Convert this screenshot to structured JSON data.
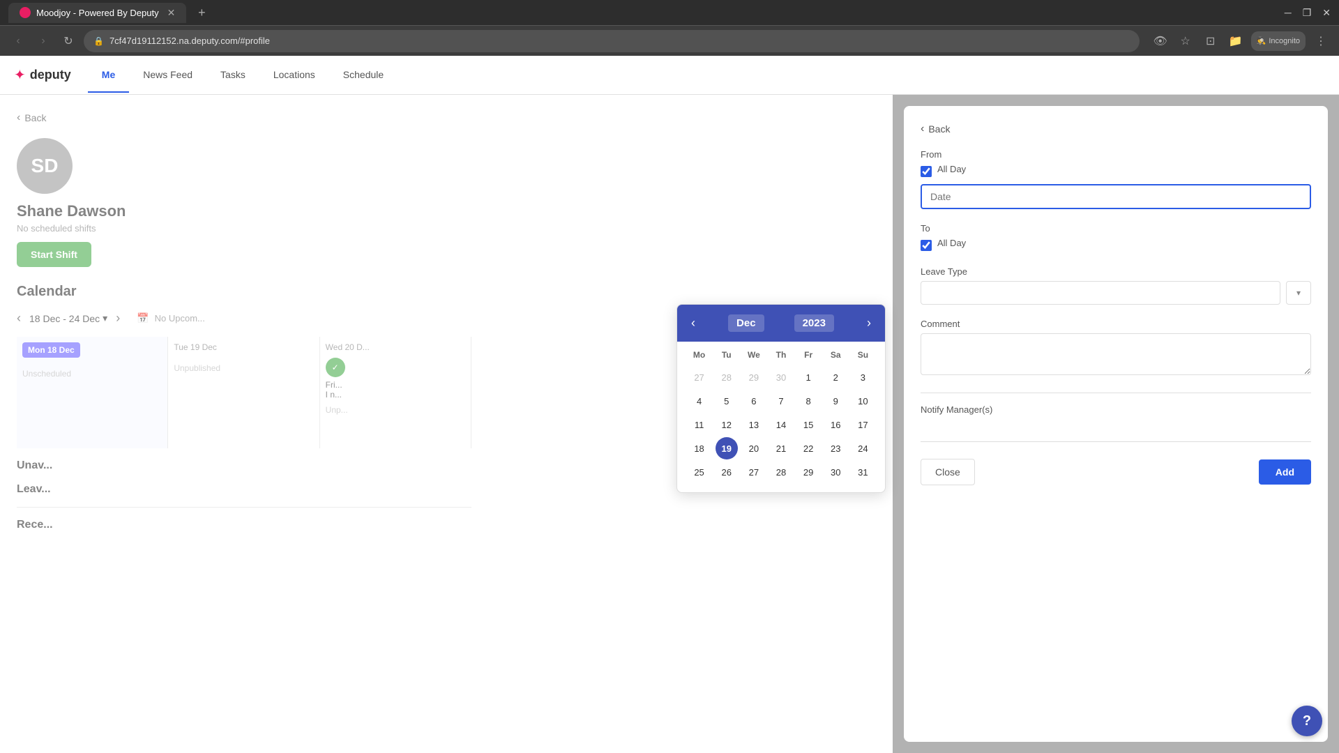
{
  "browser": {
    "tab_title": "Moodjoy - Powered By Deputy",
    "url": "7cf47d19112152.na.deputy.com/#profile",
    "incognito_label": "Incognito"
  },
  "nav": {
    "logo": "deputy",
    "tabs": [
      "Me",
      "News Feed",
      "Tasks",
      "Locations",
      "Schedule"
    ],
    "active_tab": "Me"
  },
  "profile": {
    "initials": "SD",
    "name": "Shane Dawson",
    "subtitle": "No scheduled shifts",
    "start_shift": "Start Shift"
  },
  "calendar": {
    "title": "Calendar",
    "range": "18 Dec - 24 Dec",
    "no_upcoming": "No Upcom...",
    "days": [
      {
        "label": "Mon 18 Dec",
        "active": true,
        "content": ""
      },
      {
        "label": "Tue 19 Dec",
        "active": false,
        "content": ""
      },
      {
        "label": "Wed 20 D...",
        "active": false,
        "content": ""
      }
    ],
    "unscheduled": "Unscheduled",
    "unpublished": "Unpublished",
    "unpublished2": "Unp..."
  },
  "unavailable": {
    "title": "Unav..."
  },
  "leave_section": {
    "title": "Leav..."
  },
  "recent_section": {
    "title": "Rece..."
  },
  "back_btn": "Back",
  "dialog": {
    "back_btn": "Back",
    "from_label": "From",
    "to_label": "To",
    "all_day_label": "All Day",
    "date_placeholder": "Date",
    "leave_type_label": "Leave Type",
    "comment_label": "Comment",
    "notify_label": "Notify Manager(s)",
    "close_btn": "Close",
    "add_btn": "Add"
  },
  "calendar_picker": {
    "month": "Dec",
    "year": "2023",
    "day_names": [
      "Mo",
      "Tu",
      "We",
      "Th",
      "Fr",
      "Sa",
      "Su"
    ],
    "weeks": [
      [
        {
          "day": "27",
          "type": "other"
        },
        {
          "day": "28",
          "type": "other"
        },
        {
          "day": "29",
          "type": "other"
        },
        {
          "day": "30",
          "type": "other"
        },
        {
          "day": "1",
          "type": "normal"
        },
        {
          "day": "2",
          "type": "normal"
        },
        {
          "day": "3",
          "type": "normal"
        }
      ],
      [
        {
          "day": "4",
          "type": "normal"
        },
        {
          "day": "5",
          "type": "normal"
        },
        {
          "day": "6",
          "type": "normal"
        },
        {
          "day": "7",
          "type": "normal"
        },
        {
          "day": "8",
          "type": "normal"
        },
        {
          "day": "9",
          "type": "normal"
        },
        {
          "day": "10",
          "type": "normal"
        }
      ],
      [
        {
          "day": "11",
          "type": "normal"
        },
        {
          "day": "12",
          "type": "normal"
        },
        {
          "day": "13",
          "type": "normal"
        },
        {
          "day": "14",
          "type": "normal"
        },
        {
          "day": "15",
          "type": "normal"
        },
        {
          "day": "16",
          "type": "normal"
        },
        {
          "day": "17",
          "type": "normal"
        }
      ],
      [
        {
          "day": "18",
          "type": "normal"
        },
        {
          "day": "19",
          "type": "today"
        },
        {
          "day": "20",
          "type": "normal"
        },
        {
          "day": "21",
          "type": "normal"
        },
        {
          "day": "22",
          "type": "normal"
        },
        {
          "day": "23",
          "type": "normal"
        },
        {
          "day": "24",
          "type": "normal"
        }
      ],
      [
        {
          "day": "25",
          "type": "normal"
        },
        {
          "day": "26",
          "type": "normal"
        },
        {
          "day": "27",
          "type": "normal"
        },
        {
          "day": "28",
          "type": "normal"
        },
        {
          "day": "29",
          "type": "normal"
        },
        {
          "day": "30",
          "type": "normal"
        },
        {
          "day": "31",
          "type": "normal"
        }
      ]
    ]
  },
  "help": {
    "icon": "?"
  }
}
